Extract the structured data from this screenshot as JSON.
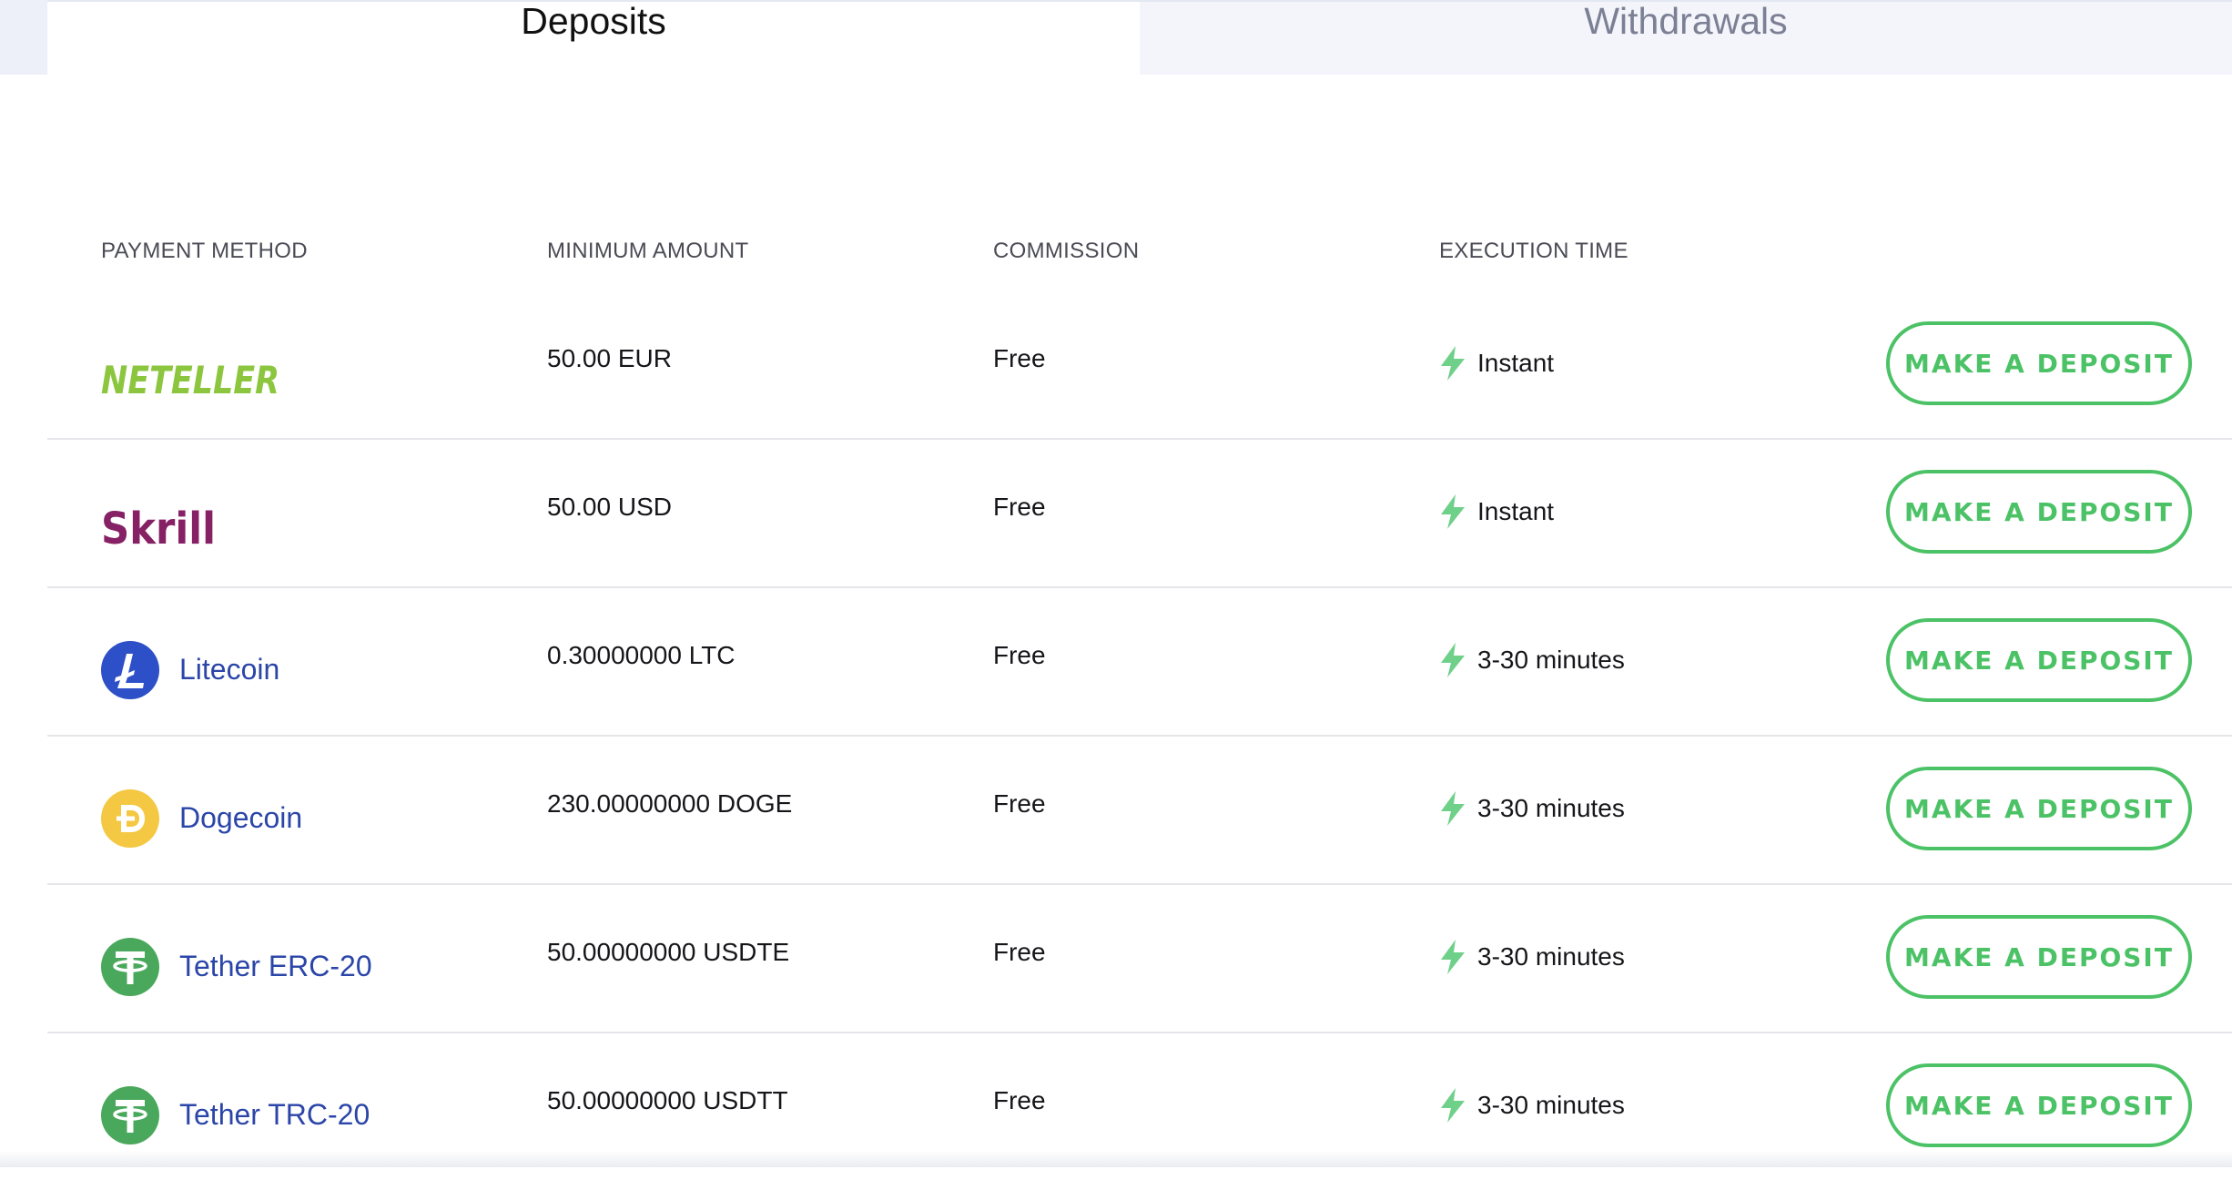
{
  "tabs": {
    "deposits": "Deposits",
    "withdrawals": "Withdrawals"
  },
  "table": {
    "headers": {
      "method": "PAYMENT METHOD",
      "minimum": "MINIMUM AMOUNT",
      "commission": "COMMISSION",
      "execution": "EXECUTION TIME"
    },
    "rows": [
      {
        "method": "NETELLER",
        "logo": "neteller-logo",
        "minimum": "50.00 EUR",
        "commission": "Free",
        "execution": "Instant",
        "action": "MAKE A DEPOSIT"
      },
      {
        "method": "Skrill",
        "logo": "skrill-logo",
        "minimum": "50.00 USD",
        "commission": "Free",
        "execution": "Instant",
        "action": "MAKE A DEPOSIT"
      },
      {
        "method": "Litecoin",
        "logo": "litecoin-icon",
        "minimum": "0.30000000 LTC",
        "commission": "Free",
        "execution": "3-30 minutes",
        "action": "MAKE A DEPOSIT"
      },
      {
        "method": "Dogecoin",
        "logo": "dogecoin-icon",
        "minimum": "230.00000000 DOGE",
        "commission": "Free",
        "execution": "3-30 minutes",
        "action": "MAKE A DEPOSIT"
      },
      {
        "method": "Tether ERC-20",
        "logo": "tether-icon",
        "minimum": "50.00000000 USDTE",
        "commission": "Free",
        "execution": "3-30 minutes",
        "action": "MAKE A DEPOSIT"
      },
      {
        "method": "Tether TRC-20",
        "logo": "tether-icon",
        "minimum": "50.00000000 USDTT",
        "commission": "Free",
        "execution": "3-30 minutes",
        "action": "MAKE A DEPOSIT"
      }
    ]
  },
  "colors": {
    "accent_green": "#4cc266",
    "bolt_green": "#6fd08a",
    "link_blue": "#2b46a8",
    "neteller_green": "#8cc63f",
    "skrill_purple": "#862165",
    "litecoin_blue": "#2d4fc7",
    "dogecoin_yellow": "#f4c842",
    "tether_green": "#4aa85c"
  }
}
